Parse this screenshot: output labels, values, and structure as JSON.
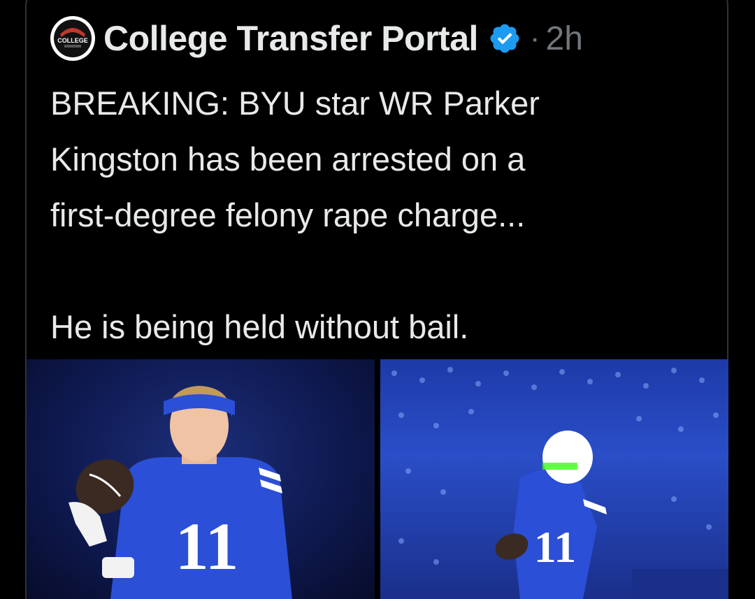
{
  "tweet": {
    "author_name": "College Transfer Portal",
    "avatar_text": "COLLEGE",
    "separator": "·",
    "timestamp": "2h",
    "text": "BREAKING: BYU star WR Parker\nKingston has been arrested on a\nfirst-degree felony rape charge...\n\nHe is being held without bail."
  },
  "media": {
    "photos": [
      {
        "jersey_number": "11"
      },
      {
        "jersey_number": "11"
      }
    ]
  },
  "colors": {
    "background": "#000000",
    "text": "#e7e9ea",
    "secondary_text": "#71767b",
    "verified_badge": "#1d9bf0",
    "byu_blue": "#2b4fd6"
  }
}
